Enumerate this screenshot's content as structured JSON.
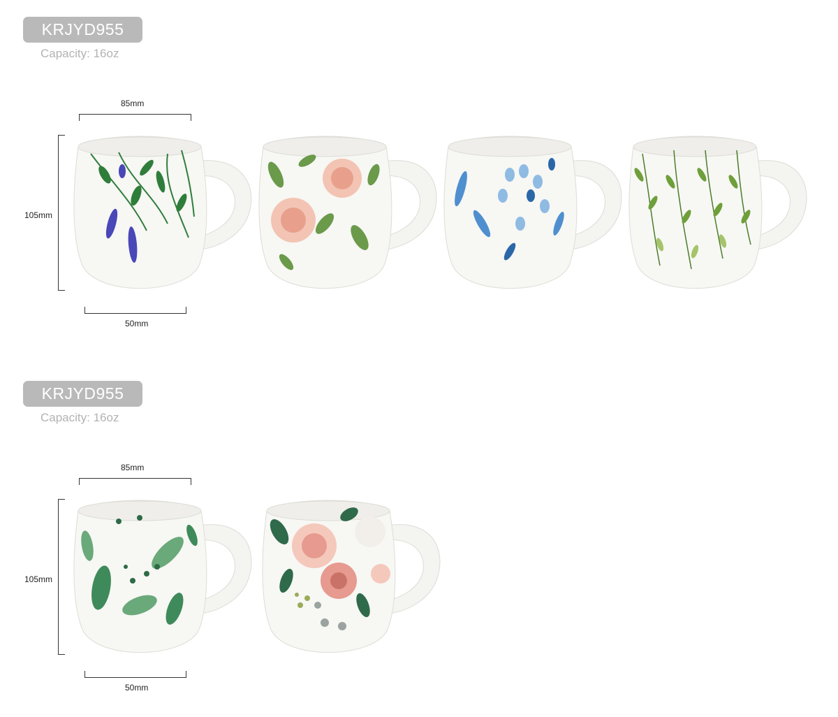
{
  "sections": [
    {
      "code": "KRJYD955",
      "capacity": "Capacity: 16oz",
      "dims": {
        "top": "85mm",
        "side": "105mm",
        "bottom": "50mm"
      },
      "mugs": [
        {
          "pattern": "leaves-lavender",
          "colors": [
            "#2f7d3a",
            "#4a47b8",
            "#6ea56a"
          ]
        },
        {
          "pattern": "roses",
          "colors": [
            "#e8a08c",
            "#6a9a4a",
            "#f3c4b3"
          ]
        },
        {
          "pattern": "blue-leaves",
          "colors": [
            "#4f8fcf",
            "#2b67a8",
            "#8fbbe3"
          ]
        },
        {
          "pattern": "green-vines",
          "colors": [
            "#6f9f3a",
            "#4b7d2a",
            "#a5c46a"
          ]
        }
      ]
    },
    {
      "code": "KRJYD955",
      "capacity": "Capacity: 16oz",
      "dims": {
        "top": "85mm",
        "side": "105mm",
        "bottom": "50mm"
      },
      "mugs": [
        {
          "pattern": "eucalyptus",
          "colors": [
            "#3f8a5a",
            "#6aa97a",
            "#2d6a45"
          ]
        },
        {
          "pattern": "peonies",
          "colors": [
            "#e79a8f",
            "#2f6a4a",
            "#f5c8bc"
          ]
        }
      ]
    }
  ]
}
